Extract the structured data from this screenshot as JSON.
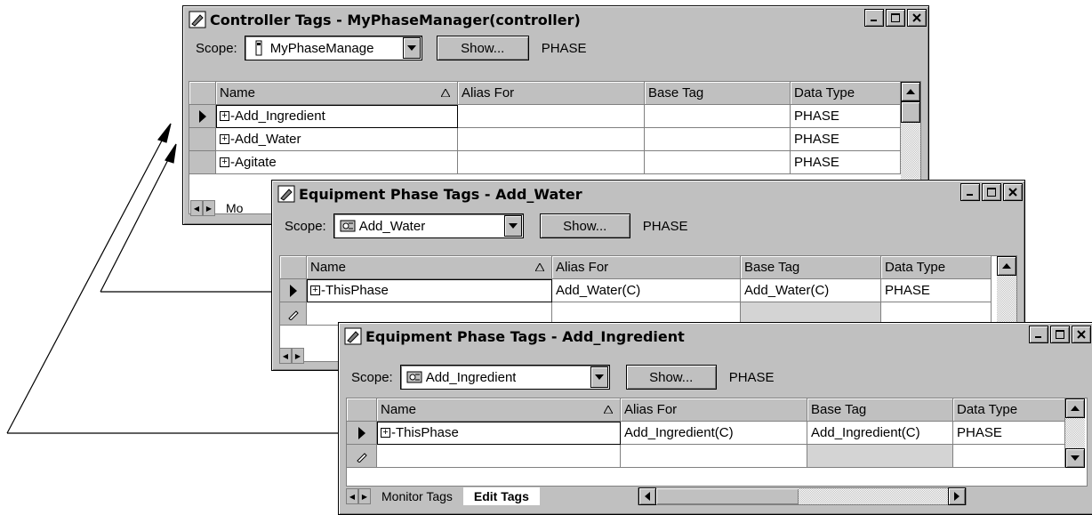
{
  "window1": {
    "title": "Controller Tags - MyPhaseManager(controller)",
    "scope_label": "Scope:",
    "scope_value": "MyPhaseManage",
    "show_button": "Show...",
    "filter": "PHASE",
    "columns": [
      "Name",
      "Alias For",
      "Base Tag",
      "Data Type"
    ],
    "rows": [
      {
        "name": "-Add_Ingredient",
        "alias": "",
        "base": "",
        "type": "PHASE"
      },
      {
        "name": "-Add_Water",
        "alias": "",
        "base": "",
        "type": "PHASE"
      },
      {
        "name": "-Agitate",
        "alias": "",
        "base": "",
        "type": "PHASE"
      }
    ],
    "tab_partial": "Mo"
  },
  "window2": {
    "title": "Equipment Phase Tags - Add_Water",
    "scope_label": "Scope:",
    "scope_value": "Add_Water",
    "show_button": "Show...",
    "filter": "PHASE",
    "columns": [
      "Name",
      "Alias For",
      "Base Tag",
      "Data Type"
    ],
    "rows": [
      {
        "name": "-ThisPhase",
        "alias": "Add_Water(C)",
        "base": "Add_Water(C)",
        "type": "PHASE"
      }
    ]
  },
  "window3": {
    "title": "Equipment Phase Tags - Add_Ingredient",
    "scope_label": "Scope:",
    "scope_value": "Add_Ingredient",
    "show_button": "Show...",
    "filter": "PHASE",
    "columns": [
      "Name",
      "Alias For",
      "Base Tag",
      "Data Type"
    ],
    "rows": [
      {
        "name": "-ThisPhase",
        "alias": "Add_Ingredient(C)",
        "base": "Add_Ingredient(C)",
        "type": "PHASE"
      }
    ],
    "tabs": [
      "Monitor Tags",
      "Edit Tags"
    ]
  }
}
